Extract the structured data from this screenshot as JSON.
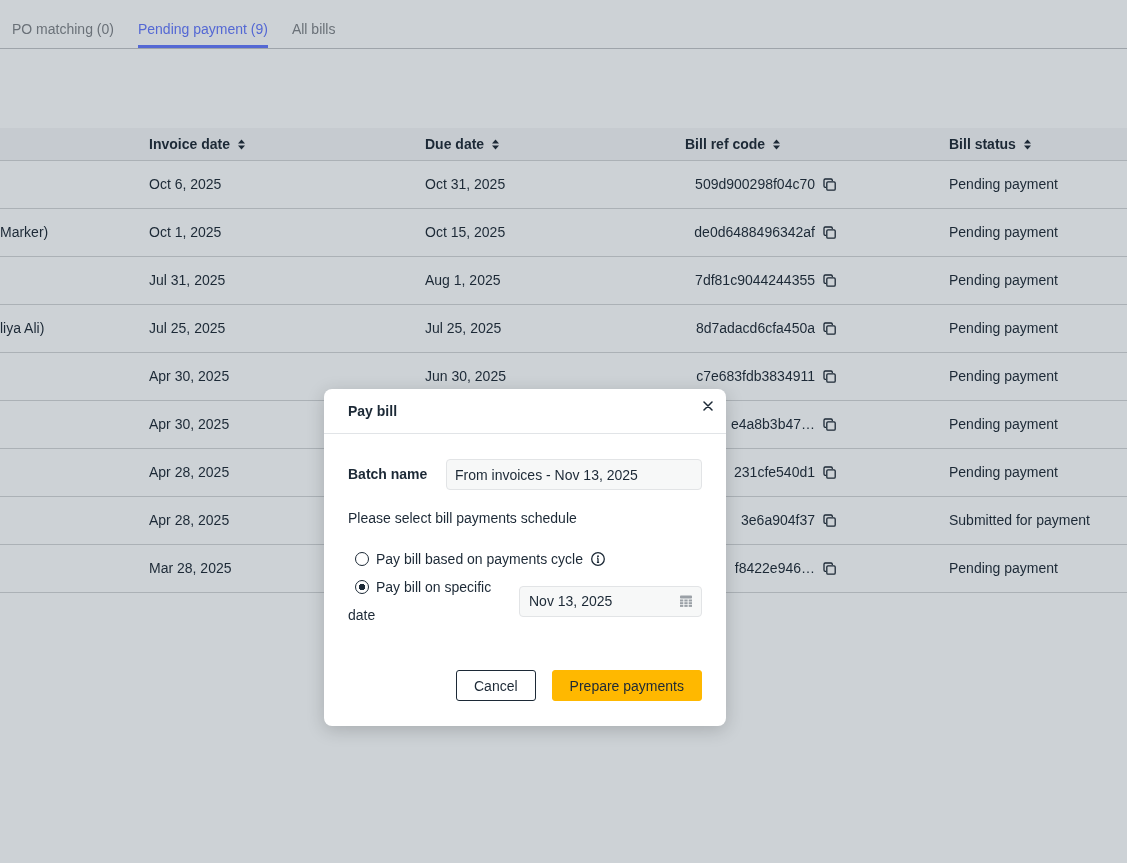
{
  "tabs": [
    {
      "label": "PO matching (0)",
      "selected": false
    },
    {
      "label": "Pending payment (9)",
      "selected": true
    },
    {
      "label": "All bills",
      "selected": false
    }
  ],
  "table": {
    "columns": [
      {
        "label": "Invoice date"
      },
      {
        "label": "Due date"
      },
      {
        "label": "Bill ref code"
      },
      {
        "label": "Bill status"
      }
    ],
    "rows": [
      {
        "invoice_date": "Oct 6, 2025",
        "due_date": "Oct 31, 2025",
        "bill_ref_code": "509d900298f04c70",
        "bill_status": "Pending payment"
      },
      {
        "column_1": "Marker)",
        "invoice_date": "Oct 1, 2025",
        "due_date": "Oct 15, 2025",
        "bill_ref_code": "de0d6488496342af",
        "bill_status": "Pending payment"
      },
      {
        "invoice_date": "Jul 31, 2025",
        "due_date": "Aug 1, 2025",
        "bill_ref_code": "7df81c9044244355",
        "bill_status": "Pending payment"
      },
      {
        "column_1": "liya Ali)",
        "invoice_date": "Jul 25, 2025",
        "due_date": "Jul 25, 2025",
        "bill_ref_code": "8d7adacd6cfa450a",
        "bill_status": "Pending payment"
      },
      {
        "invoice_date": "Apr 30, 2025",
        "due_date": "Jun 30, 2025",
        "bill_ref_code": "c7e683fdb3834911",
        "bill_status": "Pending payment"
      },
      {
        "invoice_date": "Apr 30, 2025",
        "bill_ref_code": "e4a8b3b47…",
        "bill_status": "Pending payment"
      },
      {
        "invoice_date": "Apr 28, 2025",
        "bill_ref_code": "231cfe540d1",
        "bill_status": "Pending payment"
      },
      {
        "invoice_date": "Apr 28, 2025",
        "bill_ref_code": "3e6a904f37",
        "bill_status": "Submitted for payment"
      },
      {
        "invoice_date": "Mar 28, 2025",
        "bill_ref_code": "f8422e946…",
        "bill_status": "Pending payment"
      }
    ]
  },
  "dialog": {
    "title": "Pay bill",
    "batch_name": {
      "label": "Batch name",
      "value": "From invoices - Nov 13, 2025"
    },
    "prompt": "Please select bill payments schedule",
    "options": [
      {
        "kind": "info",
        "label": "Pay bill based on payments cycle",
        "selected": false
      },
      {
        "kind": "date",
        "label": "Pay bill on specific date",
        "selected": true,
        "date_value": "Nov 13, 2025"
      }
    ],
    "buttons": [
      {
        "kind": "secondary",
        "label": "Cancel"
      },
      {
        "kind": "primary",
        "label": "Prepare payments"
      }
    ]
  }
}
